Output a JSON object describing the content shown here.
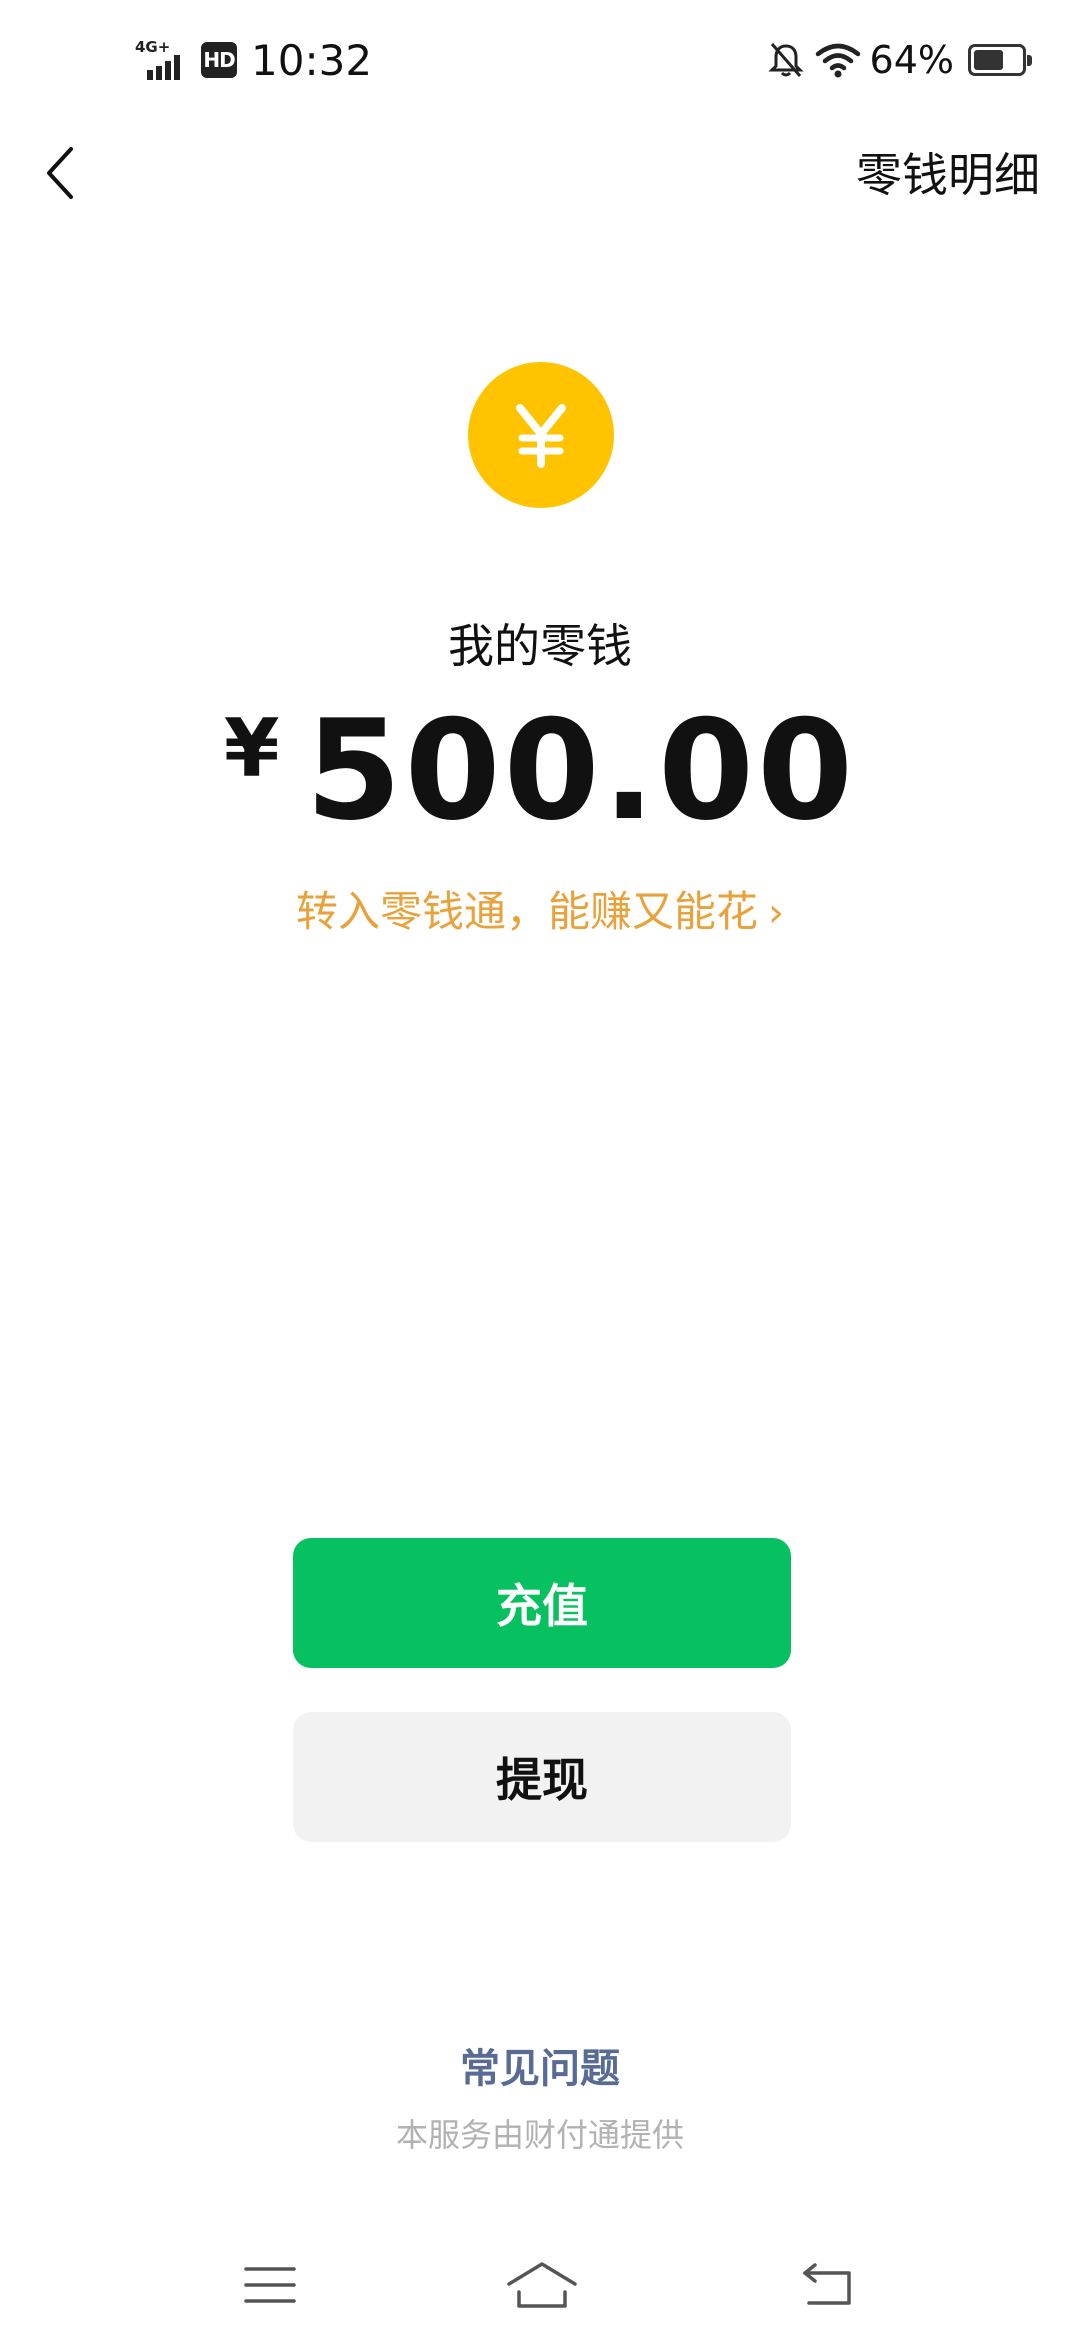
{
  "status_bar": {
    "network": "4G+",
    "hd": "HD",
    "time": "10:32",
    "battery_text": "64%",
    "battery_level": 0.64
  },
  "header": {
    "detail_label": "零钱明细"
  },
  "wallet": {
    "label": "我的零钱",
    "currency": "¥",
    "amount": "500.00",
    "promo": "转入零钱通，能赚又能花",
    "promo_chevron": "›"
  },
  "actions": {
    "recharge_label": "充值",
    "withdraw_label": "提现"
  },
  "footer": {
    "faq_label": "常见问题",
    "provider_text": "本服务由财付通提供"
  },
  "colors": {
    "brand_green": "#07C160",
    "coin_yellow": "#FFC300",
    "promo_orange": "#E9A23B",
    "link_blue": "#576B95"
  },
  "icons": {
    "back": "chevron-left-icon",
    "coin": "yuan-coin-icon",
    "nav_menu": "menu-icon",
    "nav_home": "home-icon",
    "nav_back": "back-arrow-icon"
  }
}
